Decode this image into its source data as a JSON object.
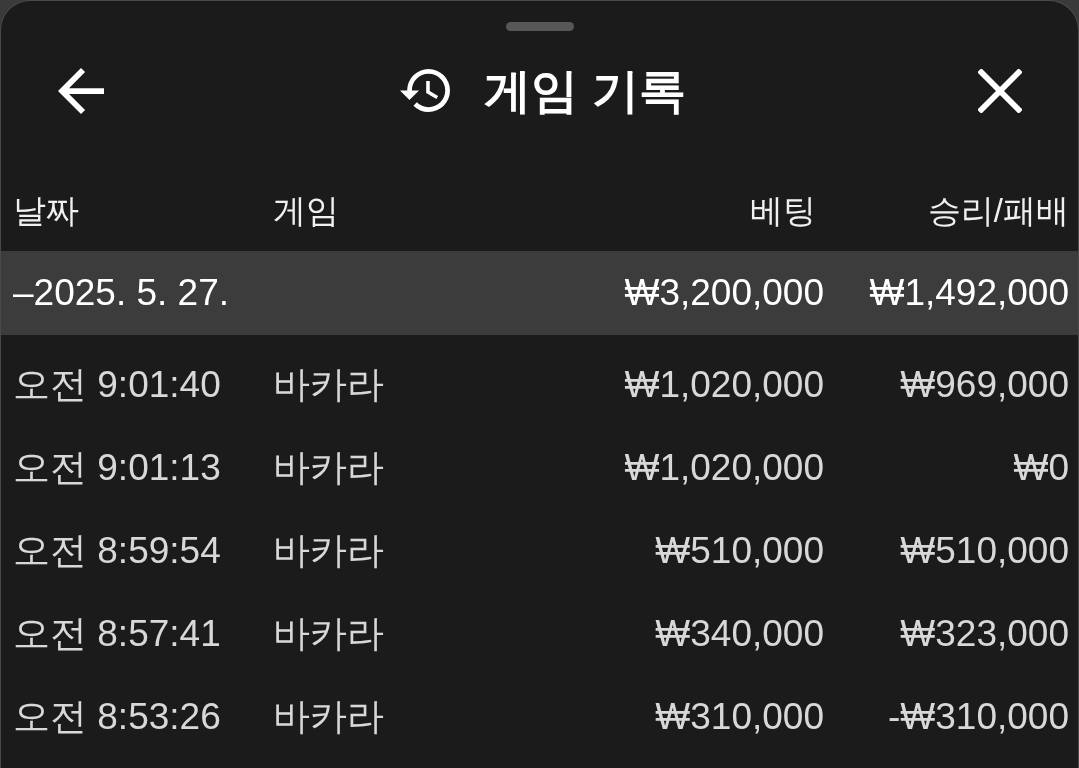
{
  "header": {
    "title": "게임 기록"
  },
  "table": {
    "columns": [
      "날짜",
      "게임",
      "베팅",
      "승리/패배"
    ],
    "groups": [
      {
        "date": "–2025. 5. 27.",
        "bet": "₩3,200,000",
        "result": "₩1,492,000",
        "rows": [
          {
            "time": "오전 9:01:40",
            "game": "바카라",
            "bet": "₩1,020,000",
            "result": "₩969,000"
          },
          {
            "time": "오전 9:01:13",
            "game": "바카라",
            "bet": "₩1,020,000",
            "result": "₩0"
          },
          {
            "time": "오전 8:59:54",
            "game": "바카라",
            "bet": "₩510,000",
            "result": "₩510,000"
          },
          {
            "time": "오전 8:57:41",
            "game": "바카라",
            "bet": "₩340,000",
            "result": "₩323,000"
          },
          {
            "time": "오전 8:53:26",
            "game": "바카라",
            "bet": "₩310,000",
            "result": "-₩310,000"
          }
        ]
      }
    ]
  }
}
